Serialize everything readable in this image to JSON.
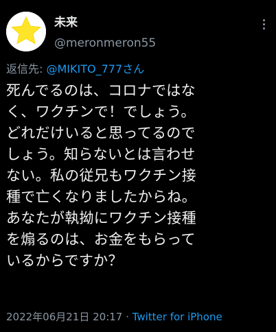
{
  "user": {
    "display_name": "未来",
    "handle": "@meronmeron55",
    "avatar_icon": "yellow-star-icon"
  },
  "more_icon": "more-dots-icon",
  "reply": {
    "prefix": "返信先: ",
    "mention": "@MIKITO_777さん"
  },
  "body": {
    "lines": [
      "死んでるのは、コロナではな",
      "く、ワクチンで！でしょう。",
      "どれだけいると思ってるので",
      "しょう。知らないとは言わせ",
      "ない。私の従兄もワクチン接",
      "種で亡くなりましたからね。",
      "あなたが執拗にワクチン接種",
      "を煽るのは、お金をもらって",
      "いるからですか？"
    ]
  },
  "meta": {
    "timestamp": "2022年06月21日 20:17",
    "separator": " · ",
    "source": "Twitter for iPhone"
  },
  "colors": {
    "background": "#000000",
    "text": "#e7e9ea",
    "muted": "#8b98a5",
    "link": "#1d9bf0",
    "star": "#ffe52a"
  }
}
